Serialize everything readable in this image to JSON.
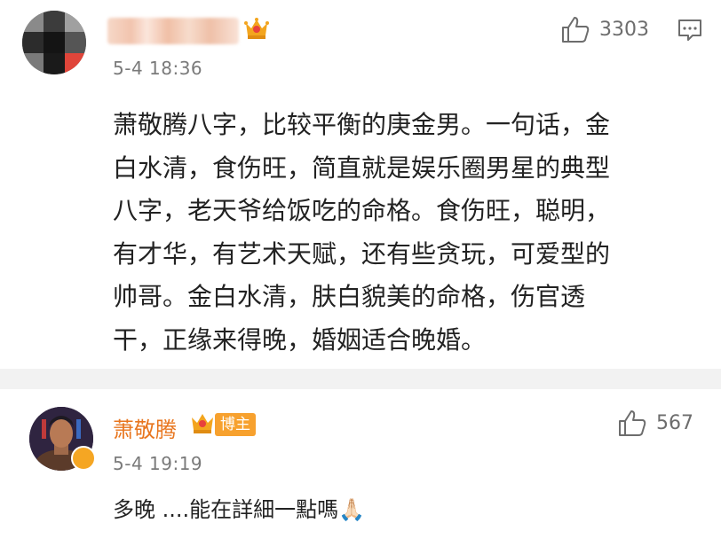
{
  "comment_main": {
    "timestamp": "5-4 18:36",
    "like_count": "3303",
    "lines": [
      "萧敬腾八字，比较平衡的庚金男。一句话，金",
      "白水清，食伤旺，简直就是娱乐圈男星的典型",
      "八字，老天爷给饭吃的命格。食伤旺，聪明，",
      "有才华，有艺术天赋，还有些贪玩，可爱型的",
      "帅哥。金白水清，肤白貌美的命格，伤官透",
      "干，正缘来得晚，婚姻适合晚婚。"
    ]
  },
  "reply": {
    "author": "萧敬腾",
    "badge": "博主",
    "timestamp": "5-4 19:19",
    "like_count": "567",
    "text": "多晚 ....能在詳細一點嗎🙏🏻"
  },
  "colors": {
    "author": "#e8761f",
    "badge_bg": "#f7a12e",
    "divider": "#f2f2f2",
    "meta_text": "#7a7a7a"
  },
  "icons": [
    "thumbs-up-icon",
    "comment-icon",
    "crown-icon",
    "verified-icon"
  ]
}
